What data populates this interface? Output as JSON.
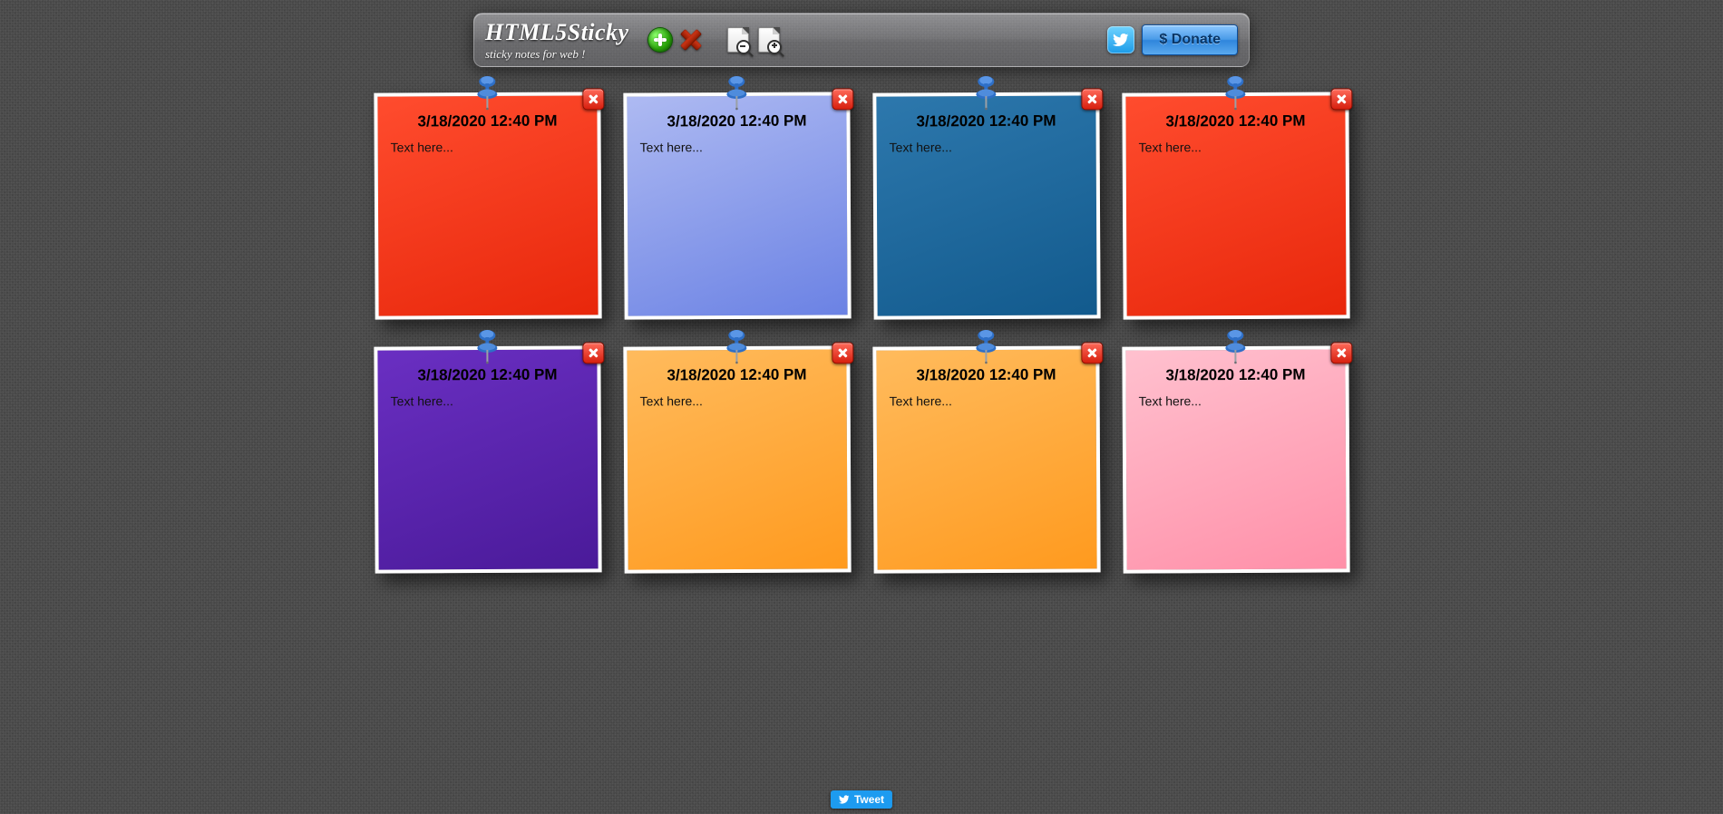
{
  "header": {
    "title": "HTML5Sticky",
    "subtitle": "sticky notes for web !",
    "donate_label": "$ Donate"
  },
  "notes": [
    {
      "timestamp": "3/18/2020 12:40 PM",
      "body": "Text here...",
      "color": "c-red"
    },
    {
      "timestamp": "3/18/2020 12:40 PM",
      "body": "Text here...",
      "color": "c-lightblue"
    },
    {
      "timestamp": "3/18/2020 12:40 PM",
      "body": "Text here...",
      "color": "c-blue"
    },
    {
      "timestamp": "3/18/2020 12:40 PM",
      "body": "Text here...",
      "color": "c-red"
    },
    {
      "timestamp": "3/18/2020 12:40 PM",
      "body": "Text here...",
      "color": "c-purple"
    },
    {
      "timestamp": "3/18/2020 12:40 PM",
      "body": "Text here...",
      "color": "c-orange"
    },
    {
      "timestamp": "3/18/2020 12:40 PM",
      "body": "Text here...",
      "color": "c-orange"
    },
    {
      "timestamp": "3/18/2020 12:40 PM",
      "body": "Text here...",
      "color": "c-pink"
    }
  ],
  "footer": {
    "tweet_label": "Tweet"
  }
}
